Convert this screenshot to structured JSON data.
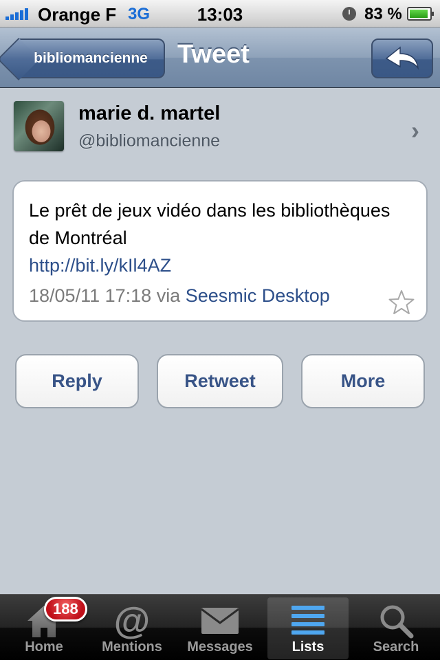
{
  "status_bar": {
    "carrier": "Orange F",
    "network": "3G",
    "time": "13:03",
    "battery": "83 %",
    "battery_level": 0.83
  },
  "nav": {
    "back_label": "bibliomancienne",
    "title": "Tweet",
    "action_icon": "reply-arrow-icon"
  },
  "profile": {
    "name": "marie d. martel",
    "handle": "@bibliomancienne"
  },
  "tweet": {
    "text": "Le prêt de jeux vidéo dans les bibliothèques de Montréal",
    "link": "http://bit.ly/kIl4AZ",
    "timestamp": "18/05/11 17:18",
    "via": "via",
    "source": "Seesmic Desktop"
  },
  "actions": {
    "reply": "Reply",
    "retweet": "Retweet",
    "more": "More"
  },
  "tabbar": {
    "badge": "188",
    "tabs": [
      {
        "label": "Home",
        "icon": "home-icon"
      },
      {
        "label": "Mentions",
        "icon": "at-icon"
      },
      {
        "label": "Messages",
        "icon": "envelope-icon"
      },
      {
        "label": "Lists",
        "icon": "list-icon",
        "selected": true
      },
      {
        "label": "Search",
        "icon": "magnifier-icon"
      }
    ]
  },
  "colors": {
    "link": "#2d4f8a",
    "nav_bar": "#7d93ae",
    "background": "#c5ccd4",
    "badge": "#c0101a"
  }
}
